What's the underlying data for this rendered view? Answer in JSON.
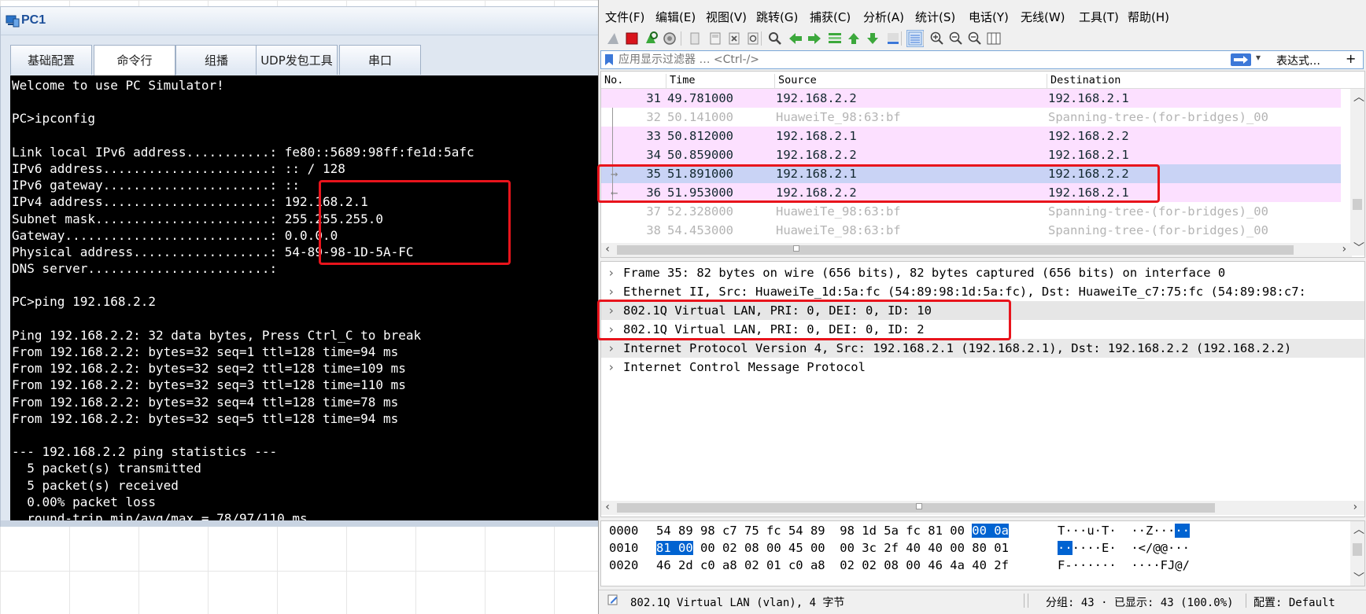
{
  "pc_window": {
    "title": "PC1",
    "tabs": [
      "基础配置",
      "命令行",
      "组播",
      "UDP发包工具",
      "串口"
    ],
    "active_tab": 1,
    "terminal_lines": [
      "Welcome to use PC Simulator!",
      "",
      "PC>ipconfig",
      "",
      "Link local IPv6 address...........: fe80::5689:98ff:fe1d:5afc",
      "IPv6 address......................: :: / 128",
      "IPv6 gateway......................: ::",
      "IPv4 address......................: 192.168.2.1",
      "Subnet mask.......................: 255.255.255.0",
      "Gateway...........................: 0.0.0.0",
      "Physical address..................: 54-89-98-1D-5A-FC",
      "DNS server........................:",
      "",
      "PC>ping 192.168.2.2",
      "",
      "Ping 192.168.2.2: 32 data bytes, Press Ctrl_C to break",
      "From 192.168.2.2: bytes=32 seq=1 ttl=128 time=94 ms",
      "From 192.168.2.2: bytes=32 seq=2 ttl=128 time=109 ms",
      "From 192.168.2.2: bytes=32 seq=3 ttl=128 time=110 ms",
      "From 192.168.2.2: bytes=32 seq=4 ttl=128 time=78 ms",
      "From 192.168.2.2: bytes=32 seq=5 ttl=128 time=94 ms",
      "",
      "--- 192.168.2.2 ping statistics ---",
      "  5 packet(s) transmitted",
      "  5 packet(s) received",
      "  0.00% packet loss",
      "  round-trip min/avg/max = 78/97/110 ms"
    ]
  },
  "wireshark": {
    "menu": [
      "文件(F)",
      "编辑(E)",
      "视图(V)",
      "跳转(G)",
      "捕获(C)",
      "分析(A)",
      "统计(S)",
      "电话(Y)",
      "无线(W)",
      "工具(T)",
      "帮助(H)"
    ],
    "toolbar_icons": [
      "shark-fin-icon",
      "stop-capture-icon",
      "restart-capture-icon",
      "capture-options-icon",
      "open-file-icon",
      "save-file-icon",
      "close-file-icon",
      "reload-file-icon",
      "find-packet-icon",
      "go-back-icon",
      "go-forward-icon",
      "go-to-packet-icon",
      "first-packet-icon",
      "last-packet-icon",
      "auto-scroll-icon",
      "colorize-icon",
      "zoom-in-icon",
      "zoom-out-icon",
      "zoom-normal-icon",
      "resize-columns-icon"
    ],
    "filter": {
      "placeholder": "应用显示过滤器 … <Ctrl-/>",
      "expression_label": "表达式…",
      "add_label": "+"
    },
    "columns": [
      "No.",
      "Time",
      "Source",
      "Destination"
    ],
    "packets": [
      {
        "no": "31",
        "time": "49.781000",
        "src": "192.168.2.2",
        "dst": "192.168.2.1",
        "kind": "icmp",
        "marker": ""
      },
      {
        "no": "32",
        "time": "50.141000",
        "src": "HuaweiTe_98:63:bf",
        "dst": "Spanning-tree-(for-bridges)_00",
        "kind": "stp",
        "marker": ""
      },
      {
        "no": "33",
        "time": "50.812000",
        "src": "192.168.2.1",
        "dst": "192.168.2.2",
        "kind": "icmp",
        "marker": ""
      },
      {
        "no": "34",
        "time": "50.859000",
        "src": "192.168.2.2",
        "dst": "192.168.2.1",
        "kind": "icmp",
        "marker": ""
      },
      {
        "no": "35",
        "time": "51.891000",
        "src": "192.168.2.1",
        "dst": "192.168.2.2",
        "kind": "sel",
        "marker": "→"
      },
      {
        "no": "36",
        "time": "51.953000",
        "src": "192.168.2.2",
        "dst": "192.168.2.1",
        "kind": "icmp",
        "marker": "←"
      },
      {
        "no": "37",
        "time": "52.328000",
        "src": "HuaweiTe_98:63:bf",
        "dst": "Spanning-tree-(for-bridges)_00",
        "kind": "stp",
        "marker": ""
      },
      {
        "no": "38",
        "time": "54.453000",
        "src": "HuaweiTe_98:63:bf",
        "dst": "Spanning-tree-(for-bridges)_00",
        "kind": "stp",
        "marker": ""
      }
    ],
    "details": [
      "Frame 35: 82 bytes on wire (656 bits), 82 bytes captured (656 bits) on interface 0",
      "Ethernet II, Src: HuaweiTe_1d:5a:fc (54:89:98:1d:5a:fc), Dst: HuaweiTe_c7:75:fc (54:89:98:c7:",
      "802.1Q Virtual LAN, PRI: 0, DEI: 0, ID: 10",
      "802.1Q Virtual LAN, PRI: 0, DEI: 0, ID: 2",
      "Internet Protocol Version 4, Src: 192.168.2.1 (192.168.2.1), Dst: 192.168.2.2 (192.168.2.2)",
      "Internet Control Message Protocol"
    ],
    "bytes": [
      {
        "offset": "0000",
        "hex_a": "54 89 98 c7 75 fc 54 89  98 1d 5a fc 81 00 ",
        "hex_hl": "00 0a",
        "hex_b": "",
        "ascii_a": "T···u·T·  ··Z···",
        "ascii_hl": "··"
      },
      {
        "offset": "0010",
        "hex_a": "",
        "hex_hl": "81 00",
        "hex_b": " 00 02 08 00 45 00  00 3c 2f 40 40 00 80 01",
        "ascii_a": "",
        "ascii_hl": "··",
        "ascii_b": "····E·  ·</@@···"
      },
      {
        "offset": "0020",
        "hex_a": "46 2d c0 a8 02 01 c0 a8  02 02 08 00 46 4a 40 2f",
        "hex_hl": "",
        "hex_b": "",
        "ascii_a": "F-······  ····FJ@/",
        "ascii_hl": ""
      }
    ],
    "status": {
      "field": "802.1Q Virtual LAN (vlan), 4 字节",
      "packets": "分组: 43 · 已显示: 43 (100.0%)",
      "profile": "配置: Default"
    }
  }
}
